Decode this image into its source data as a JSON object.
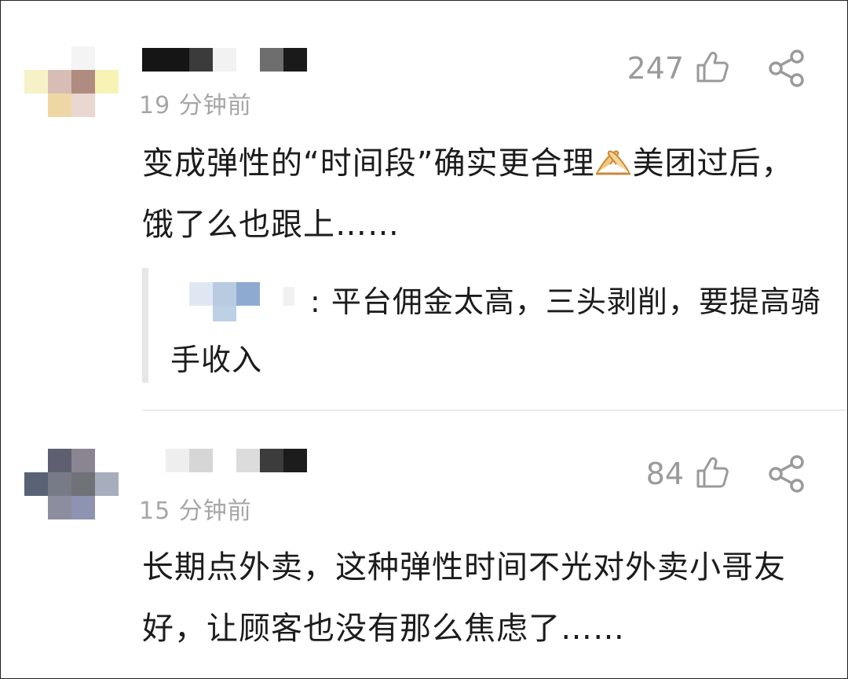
{
  "comments": [
    {
      "time": "19 分钟前",
      "likes": "247",
      "body_a": "变成弹性的“时间段”确实更合理",
      "body_b": "美团过后，饿了么也跟上……",
      "emoji": "folded-hands-emoji",
      "reply": {
        "text": ": 平台佣金太高，三头剥削，要提高骑手收入"
      }
    },
    {
      "time": "15 分钟前",
      "likes": "84",
      "body": "长期点外卖，这种弹性时间不光对外卖小哥友好，让顾客也没有那么焦虑了……"
    }
  ],
  "icons": {
    "like": "thumbs-up-outline-icon",
    "share": "share-icon"
  },
  "colors": {
    "text": "#1c1c1c",
    "meta": "#a6a6a6",
    "icon": "#9a9a9a",
    "quote_bar": "#e6e6e6"
  }
}
